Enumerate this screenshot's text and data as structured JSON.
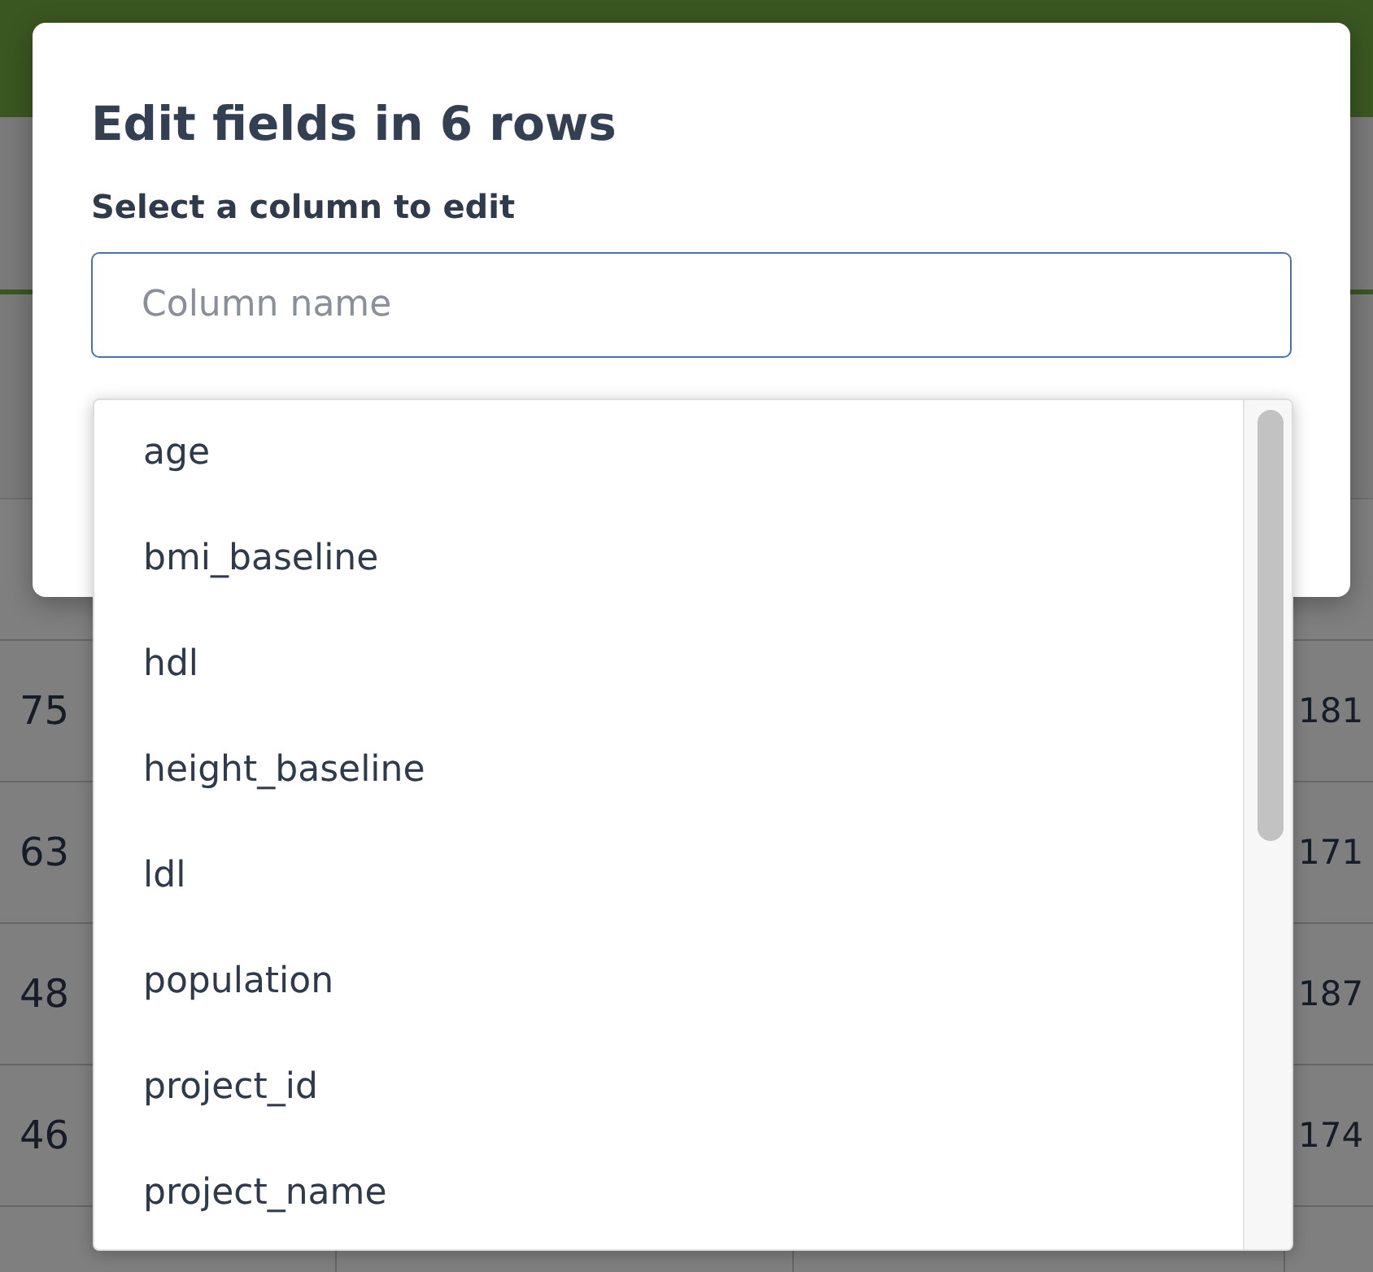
{
  "background": {
    "table": {
      "rows": [
        {
          "column_1": "75",
          "column_4": "181"
        },
        {
          "column_1": "63",
          "column_4": "171"
        },
        {
          "column_1": "48",
          "column_4": "187"
        },
        {
          "column_1": "46",
          "column_4": "174"
        }
      ]
    }
  },
  "dialog": {
    "title": "Edit fields in 6 rows",
    "label": "Select a column to edit",
    "field": {
      "placeholder": "Column name"
    }
  },
  "dropdown": {
    "options": [
      "age",
      "bmi_baseline",
      "hdl",
      "height_baseline",
      "ldl",
      "population",
      "project_id",
      "project_name"
    ]
  }
}
